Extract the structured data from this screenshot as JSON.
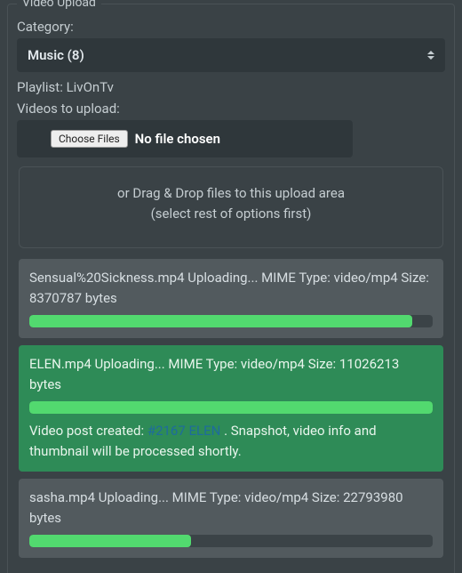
{
  "panel": {
    "title": "Video Upload"
  },
  "category": {
    "label": "Category:",
    "selected": "Music  (8)"
  },
  "playlist": {
    "label": "Playlist:",
    "value": "LivOnTv"
  },
  "videos_label": "Videos to upload:",
  "file_picker": {
    "button": "Choose Files",
    "status": "No file chosen"
  },
  "dropzone": {
    "line1": "or Drag & Drop files to this upload area",
    "line2": "(select rest of options first)"
  },
  "uploads": [
    {
      "text": "Sensual%20Sickness.mp4 Uploading... MIME Type: video/mp4 Size: 8370787 bytes",
      "progress_pct": 95,
      "style": "gray"
    },
    {
      "text": "ELEN.mp4 Uploading... MIME Type: video/mp4 Size: 11026213 bytes",
      "progress_pct": 100,
      "style": "green",
      "post": {
        "prefix": "Video post created: ",
        "link_text": "#2167 ELEN",
        "suffix": " . Snapshot, video info and thumbnail will be processed shortly."
      }
    },
    {
      "text": "sasha.mp4 Uploading... MIME Type: video/mp4 Size: 22793980 bytes",
      "progress_pct": 40,
      "style": "gray"
    }
  ]
}
